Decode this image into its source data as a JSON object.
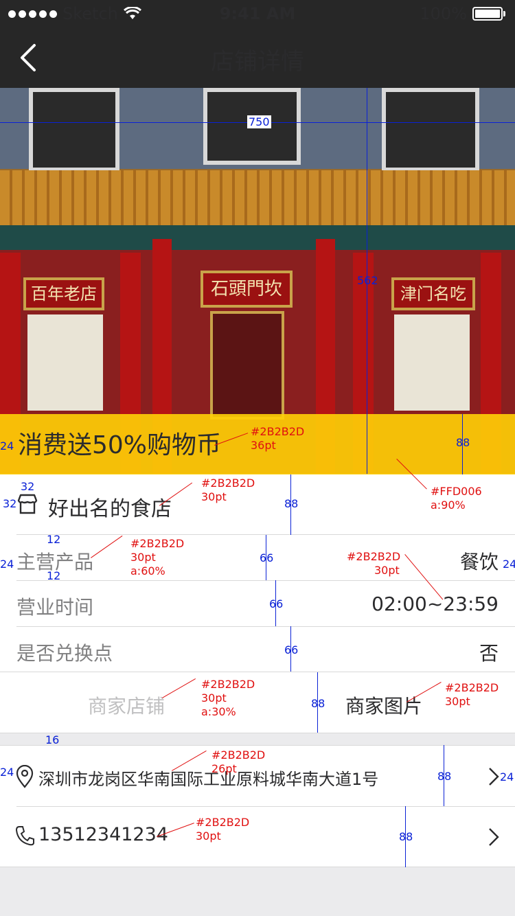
{
  "status_bar": {
    "carrier": "Sketch",
    "time": "9:41 AM",
    "battery": "100%"
  },
  "nav": {
    "title": "店铺详情",
    "back_icon": "chevron-left-icon"
  },
  "photo": {
    "banners": [
      "石頭門坎",
      "百年老店",
      "津门名吃"
    ],
    "promo_text": "消费送50%购物币",
    "promo_color": "#FFD006"
  },
  "shop": {
    "name": "好出名的食店",
    "icon": "store-icon"
  },
  "info_rows": [
    {
      "label": "主营产品",
      "value": "餐饮"
    },
    {
      "label": "营业时间",
      "value": "02:00~23:59"
    },
    {
      "label": "是否兑换点",
      "value": "否"
    }
  ],
  "tabs": {
    "left": "商家店铺",
    "right": "商家图片"
  },
  "contact": {
    "address": "深圳市龙岗区华南国际工业原料城华南大道1号",
    "phone": "13512341234",
    "address_icon": "location-pin-icon",
    "phone_icon": "phone-icon",
    "chevron_icon": "chevron-right-icon"
  },
  "annotations": {
    "color_text": "#2B2B2D",
    "pt36": "36pt",
    "pt30": "30pt",
    "pt26": "26pt",
    "a60": "a:60%",
    "a30": "a:30%",
    "yellow": "#FFD006",
    "a90": "a:90%",
    "d750": "750",
    "d562": "562",
    "d88": "88",
    "d66": "66",
    "d24": "24",
    "d32": "32",
    "d12": "12",
    "d16": "16"
  }
}
